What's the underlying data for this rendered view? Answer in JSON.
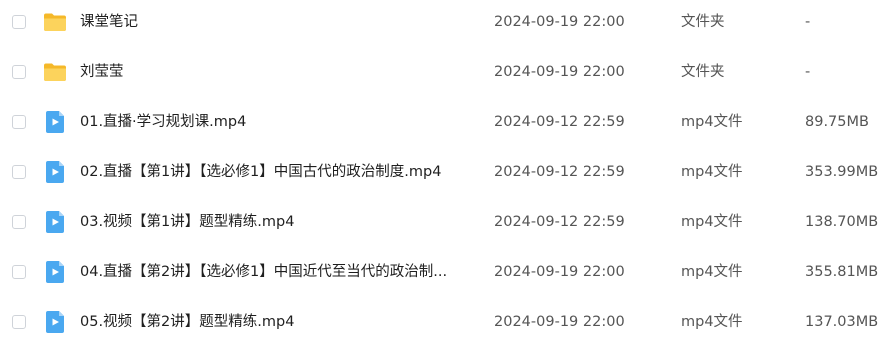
{
  "files": [
    {
      "name": "课堂笔记",
      "date": "2024-09-19 22:00",
      "type": "文件夹",
      "size": "-",
      "icon": "folder-icon"
    },
    {
      "name": "刘莹莹",
      "date": "2024-09-19 22:00",
      "type": "文件夹",
      "size": "-",
      "icon": "folder-icon"
    },
    {
      "name": "01.直播·学习规划课.mp4",
      "date": "2024-09-12 22:59",
      "type": "mp4文件",
      "size": "89.75MB",
      "icon": "video-file-icon"
    },
    {
      "name": "02.直播【第1讲】【选必修1】中国古代的政治制度.mp4",
      "date": "2024-09-12 22:59",
      "type": "mp4文件",
      "size": "353.99MB",
      "icon": "video-file-icon"
    },
    {
      "name": "03.视频【第1讲】题型精练.mp4",
      "date": "2024-09-12 22:59",
      "type": "mp4文件",
      "size": "138.70MB",
      "icon": "video-file-icon"
    },
    {
      "name": "04.直播【第2讲】【选必修1】中国近代至当代的政治制...",
      "date": "2024-09-19 22:00",
      "type": "mp4文件",
      "size": "355.81MB",
      "icon": "video-file-icon"
    },
    {
      "name": "05.视频【第2讲】题型精练.mp4",
      "date": "2024-09-19 22:00",
      "type": "mp4文件",
      "size": "137.03MB",
      "icon": "video-file-icon"
    }
  ],
  "colors": {
    "folder": "#f7c34a",
    "video": "#4aa8f0"
  }
}
